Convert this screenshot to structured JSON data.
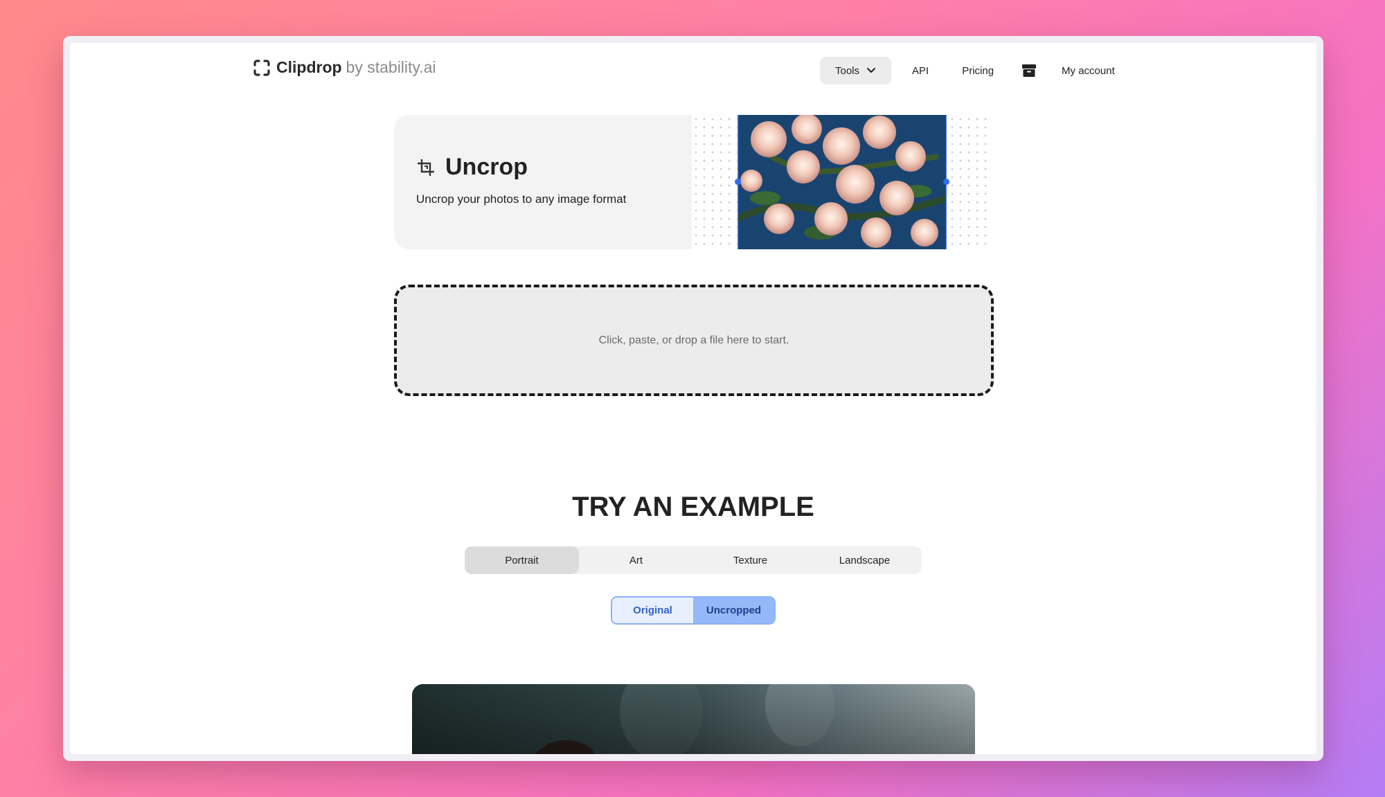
{
  "header": {
    "logo_name": "Clipdrop",
    "logo_by": "by stability.ai",
    "nav": {
      "tools_label": "Tools",
      "api_label": "API",
      "pricing_label": "Pricing",
      "account_label": "My account"
    }
  },
  "hero": {
    "title": "Uncrop",
    "subtitle": "Uncrop your photos to any image format"
  },
  "dropzone": {
    "text": "Click, paste, or drop a file here to start."
  },
  "examples": {
    "heading": "TRY AN EXAMPLE",
    "tabs": [
      {
        "label": "Portrait",
        "active": true
      },
      {
        "label": "Art",
        "active": false
      },
      {
        "label": "Texture",
        "active": false
      },
      {
        "label": "Landscape",
        "active": false
      }
    ],
    "toggle": {
      "original_label": "Original",
      "uncropped_label": "Uncropped",
      "selected": "Uncropped"
    }
  },
  "colors": {
    "accent_blue": "#95b8f8",
    "handle_blue": "#2f6df0",
    "background_gradient_start": "#ff8a8a",
    "background_gradient_end": "#b47cf5"
  },
  "icons": {
    "logo": "clipdrop-logo-icon",
    "tools_chevron": "chevron-down-icon",
    "archive": "archive-box-icon",
    "uncrop": "crop-icon"
  }
}
